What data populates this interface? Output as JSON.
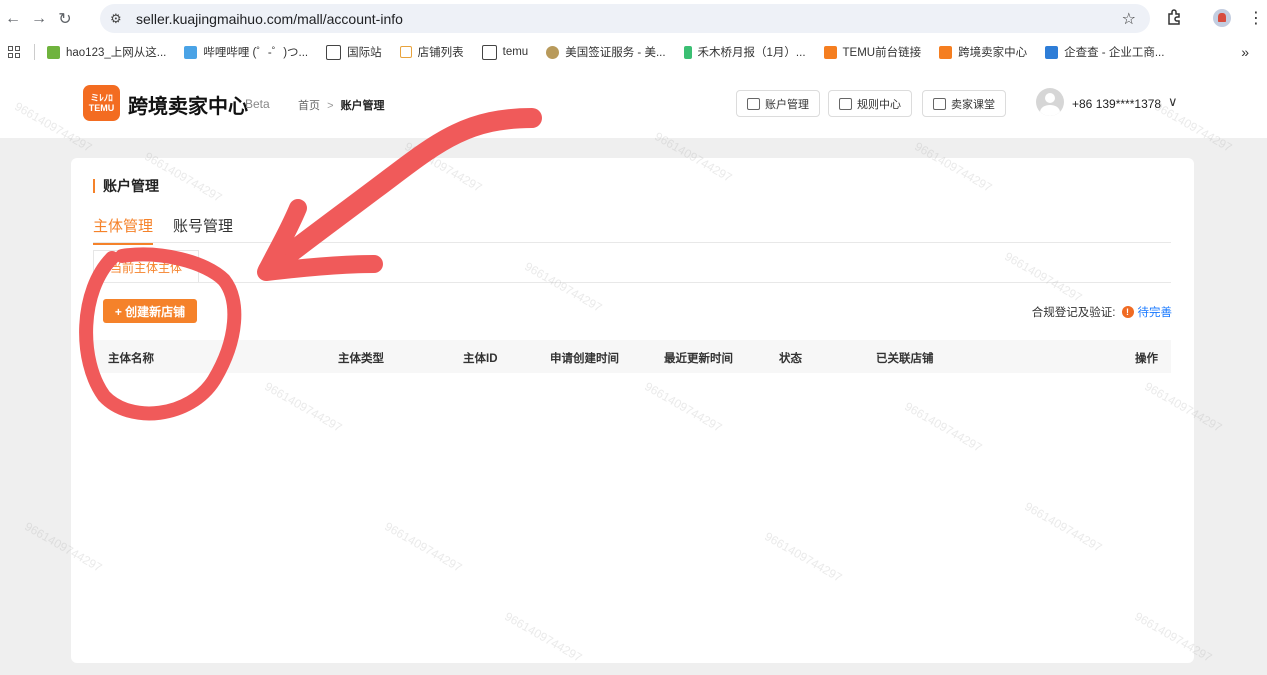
{
  "browser": {
    "url": "seller.kuajingmaihuo.com/mall/account-info",
    "bookmarks": [
      "hao123_上网从这...",
      "哔哩哔哩 (゜-゜)つ...",
      "国际站",
      "店铺列表",
      "temu",
      "美国签证服务 - 美...",
      "禾木桥月报（1月）...",
      "TEMU前台链接",
      "跨境卖家中心",
      "企查查 - 企业工商..."
    ],
    "more": "»"
  },
  "header": {
    "logo_text_top": "ミﾚﾉﾛ",
    "logo_text_bottom": "TEMU",
    "brand": "跨境卖家中心",
    "beta": "Beta",
    "crumb_home": "首页",
    "crumb_sep": ">",
    "crumb_current": "账户管理",
    "btn_account": "账户管理",
    "btn_rules": "规则中心",
    "btn_class": "卖家课堂",
    "phone": "+86 139****1378"
  },
  "main": {
    "section_title": "账户管理",
    "tabs": [
      {
        "label": "主体管理",
        "active": true
      },
      {
        "label": "账号管理",
        "active": false
      }
    ],
    "subtab": "当前主体主体",
    "create_button": "+ 创建新店铺",
    "compliance_label": "合规登记及验证:",
    "compliance_status": "待完善",
    "columns": [
      "主体名称",
      "主体类型",
      "主体ID",
      "申请创建时间",
      "最近更新时间",
      "状态",
      "已关联店铺",
      "操作"
    ]
  },
  "watermark": "9661409744297",
  "colors": {
    "accent": "#f5822a",
    "annotation": "#f05a5a",
    "link": "#1677ff"
  }
}
